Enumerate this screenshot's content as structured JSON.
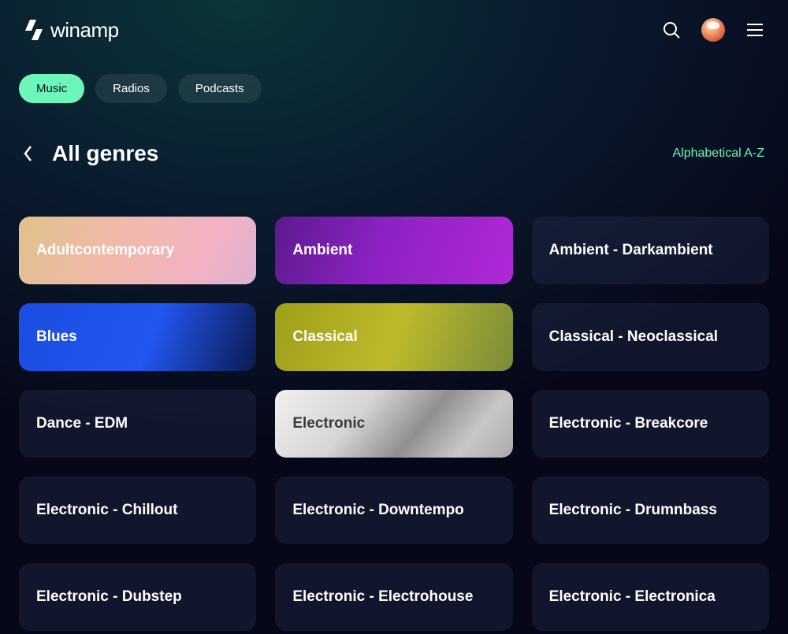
{
  "brand": "winamp",
  "tabs": [
    {
      "label": "Music",
      "active": true
    },
    {
      "label": "Radios",
      "active": false
    },
    {
      "label": "Podcasts",
      "active": false
    }
  ],
  "pageTitle": "All genres",
  "sortLabel": "Alphabetical A-Z",
  "genres": [
    {
      "label": "Adultcontemporary",
      "style": "g0"
    },
    {
      "label": "Ambient",
      "style": "g1"
    },
    {
      "label": "Ambient - Darkambient",
      "style": "plain"
    },
    {
      "label": "Blues",
      "style": "g3"
    },
    {
      "label": "Classical",
      "style": "g4"
    },
    {
      "label": "Classical - Neoclassical",
      "style": "plain"
    },
    {
      "label": "Dance - EDM",
      "style": "plain"
    },
    {
      "label": "Electronic",
      "style": "g7"
    },
    {
      "label": "Electronic - Breakcore",
      "style": "plain"
    },
    {
      "label": "Electronic - Chillout",
      "style": "plain"
    },
    {
      "label": "Electronic - Downtempo",
      "style": "plain"
    },
    {
      "label": "Electronic - Drumnbass",
      "style": "plain"
    },
    {
      "label": "Electronic - Dubstep",
      "style": "plain"
    },
    {
      "label": "Electronic - Electrohouse",
      "style": "plain"
    },
    {
      "label": "Electronic - Electronica",
      "style": "plain"
    }
  ]
}
